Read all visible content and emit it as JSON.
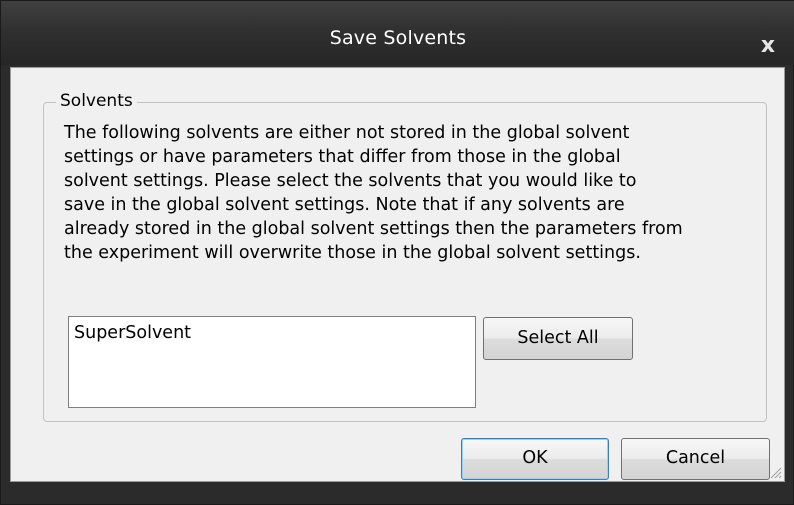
{
  "window": {
    "title": "Save Solvents",
    "close_glyph": "x"
  },
  "group": {
    "legend": "Solvents",
    "description": "The following solvents are either not stored in the global solvent\nsettings or have parameters that differ from those in the global\nsolvent settings. Please select the solvents that you would like to\nsave in the global solvent settings. Note that if any solvents are\nalready stored in the global solvent settings then the parameters from\nthe experiment will overwrite those in the global solvent settings.",
    "solvents": [
      "SuperSolvent"
    ],
    "select_all_label": "Select All"
  },
  "buttons": {
    "ok_label": "OK",
    "cancel_label": "Cancel"
  },
  "icons": {
    "close": "close-icon",
    "size_grip": "size-grip-icon"
  }
}
